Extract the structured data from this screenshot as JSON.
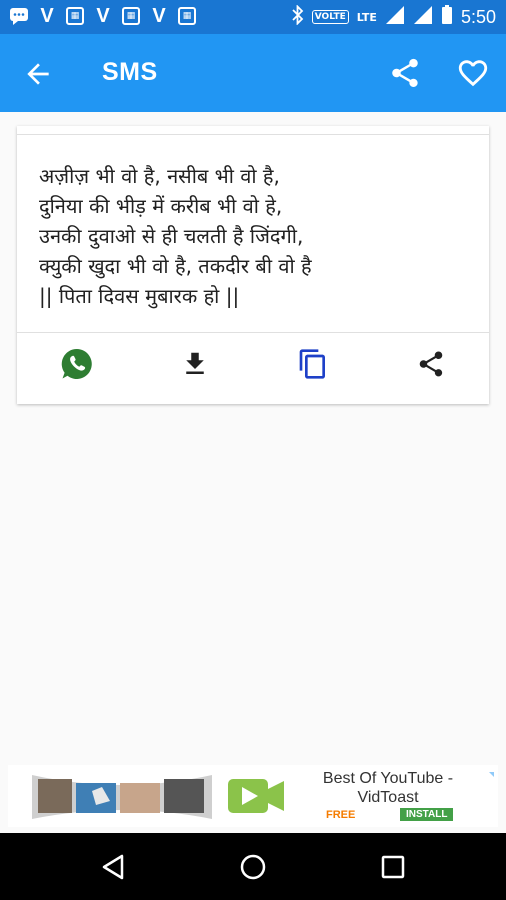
{
  "status_bar": {
    "carrier_letter": "V",
    "volte": "VOLTE",
    "lte": "LTE",
    "time": "5:50"
  },
  "app_bar": {
    "title": "SMS",
    "icons": [
      "back-arrow-icon",
      "share-icon",
      "heart-icon"
    ]
  },
  "message": {
    "lines": [
      "अज़ीज़ भी वो है, नसीब भी वो है,",
      "दुनिया की भीड़ में करीब भी वो हे,",
      "उनकी दुवाओ से ही चलती है जिंदगी,",
      "क्युकी खुदा भी वो है, तकदीर बी वो है",
      "|| पिता दिवस मुबारक हो ||"
    ]
  },
  "actions": [
    {
      "name": "whatsapp",
      "icon": "whatsapp-icon",
      "color": "#2e7d32"
    },
    {
      "name": "download",
      "icon": "download-icon",
      "color": "#212121"
    },
    {
      "name": "copy",
      "icon": "copy-icon",
      "color": "#1e40c8"
    },
    {
      "name": "share",
      "icon": "share-icon",
      "color": "#212121"
    }
  ],
  "ad": {
    "title": "Best Of YouTube - VidToast",
    "free": "FREE",
    "install": "INSTALL"
  },
  "colors": {
    "status_bar": "#1976d2",
    "app_bar": "#2196f3",
    "background": "#fafafa"
  }
}
